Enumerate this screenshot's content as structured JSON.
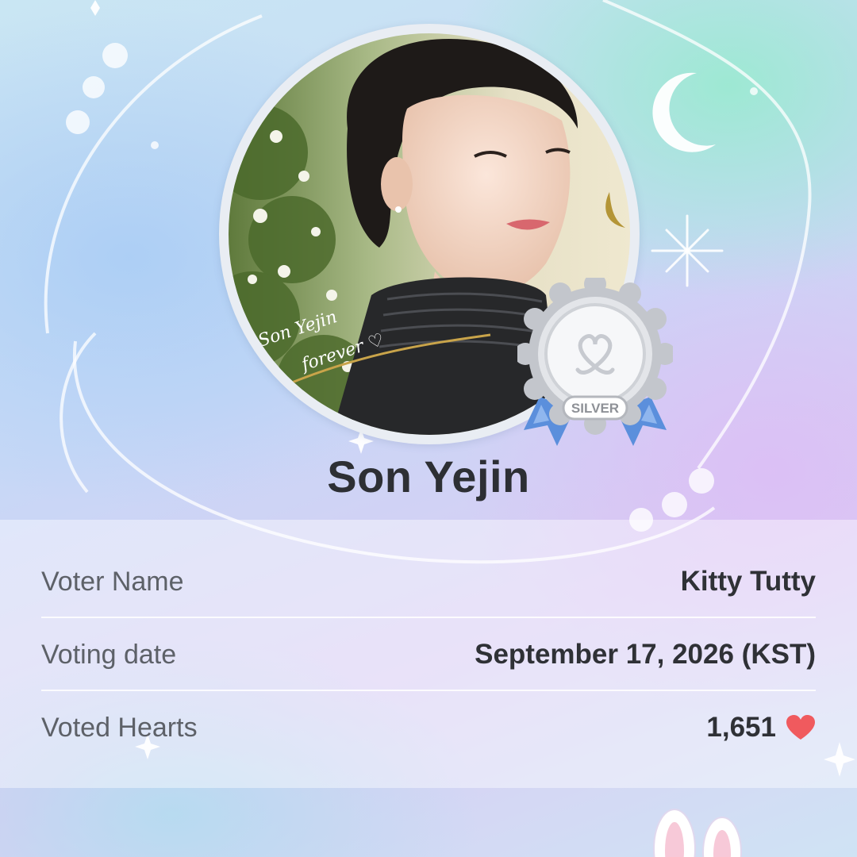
{
  "idol": {
    "name": "Son Yejin",
    "photo_caption_line1": "Son Yejin",
    "photo_caption_line2": "forever ♡",
    "medal_label": "SILVER"
  },
  "info": {
    "rows": [
      {
        "label": "Voter Name",
        "value": "Kitty Tutty"
      },
      {
        "label": "Voting date",
        "value": "September 17, 2026 (KST)"
      },
      {
        "label": "Voted Hearts",
        "value": "1,651"
      }
    ]
  },
  "icons": {
    "hearts_icon": "heart-icon",
    "medal_icon": "silver-medal-icon"
  },
  "colors": {
    "heart": "#f05a5e",
    "medal_silver": "#c9ccd2",
    "ribbon": "#5b8fdc",
    "name_text": "#2d2f34"
  }
}
